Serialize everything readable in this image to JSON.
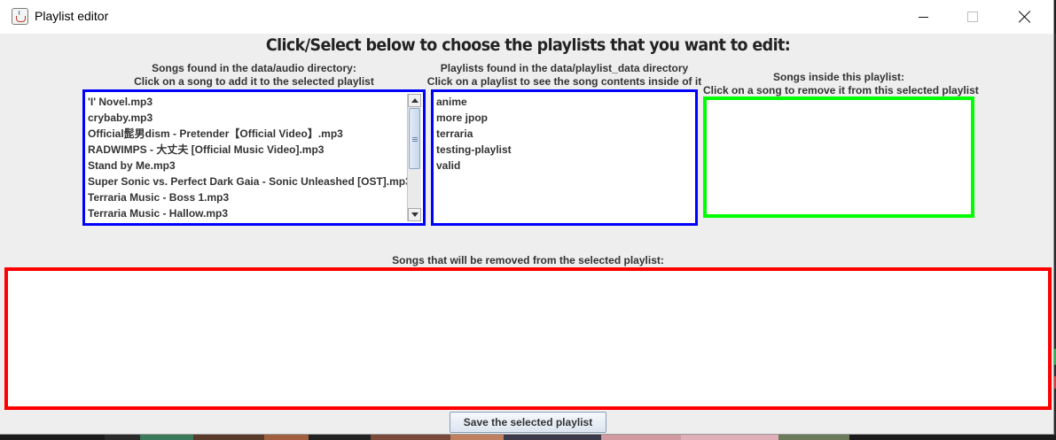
{
  "window": {
    "title": "Playlist editor",
    "icon": "java-icon",
    "controls": [
      "minimize-icon",
      "maximize-icon",
      "close-icon"
    ]
  },
  "heading": "Click/Select below to choose the playlists that you want to edit:",
  "songs_panel": {
    "label_line1": "Songs found in the data/audio directory:",
    "label_line2": "Click on a song to add it to the selected playlist",
    "items": [
      "'I' Novel.mp3",
      "crybaby.mp3",
      "Official髭男dism - Pretender【Official Video】.mp3",
      "RADWIMPS - 大丈夫 [Official Music Video].mp3",
      "Stand by Me.mp3",
      "Super Sonic vs. Perfect Dark Gaia - Sonic Unleashed [OST].mp3",
      "Terraria Music - Boss 1.mp3",
      "Terraria Music - Hallow.mp3"
    ],
    "border_color": "#0000ff"
  },
  "playlists_panel": {
    "label_line1": "Playlists found in the data/playlist_data directory",
    "label_line2": "Click on a playlist to see the song contents inside of it",
    "items": [
      "anime",
      "more jpop",
      "terraria",
      "testing-playlist",
      "valid"
    ],
    "border_color": "#0000ff"
  },
  "inside_panel": {
    "label_line1": "Songs inside this playlist:",
    "label_line2": "Click on a song to remove it from this selected playlist",
    "items": [],
    "border_color": "#00ff00"
  },
  "remove_panel": {
    "label": "Songs that will be removed from the selected playlist:",
    "items": [],
    "border_color": "#ff0000"
  },
  "save_button": "Save the selected playlist"
}
